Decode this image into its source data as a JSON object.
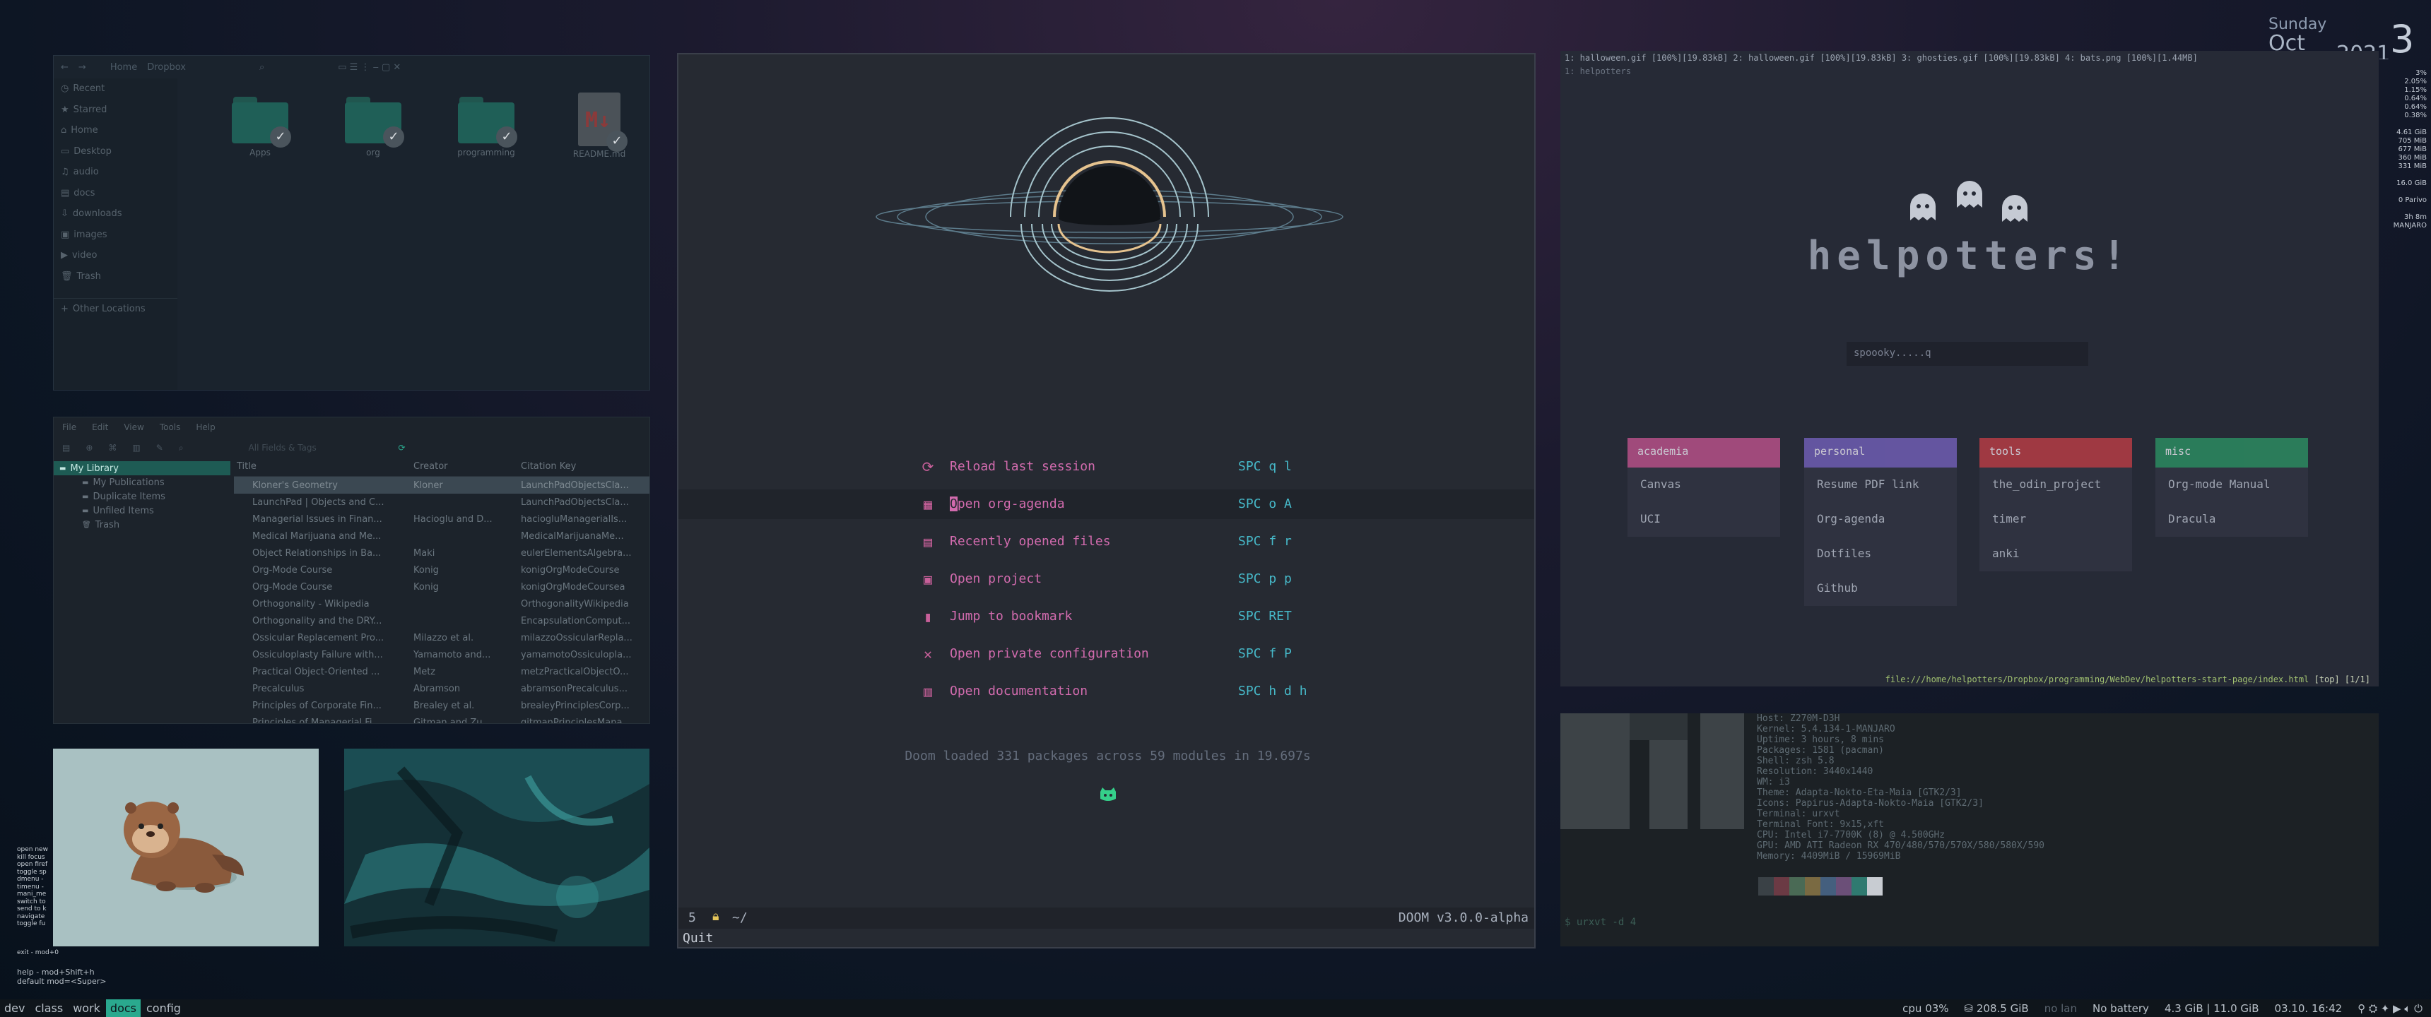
{
  "clock": {
    "day": "Sunday",
    "month": "Oct",
    "year": "2021",
    "daynum": "3"
  },
  "stats": [
    "3%",
    "2.05%",
    "1.15%",
    "0.64%",
    "0.64%",
    "0.38%",
    "",
    "4.61 GiB",
    "705 MiB",
    "677 MiB",
    "360 MiB",
    "331 MiB",
    "",
    "16.0 GiB",
    "",
    "0 Parivo",
    "",
    "3h 8m",
    "MANJARO"
  ],
  "filemanager": {
    "path": [
      "Home",
      "Dropbox"
    ],
    "sidebar": [
      "Recent",
      "Starred",
      "Home",
      "Desktop",
      "audio",
      "docs",
      "downloads",
      "images",
      "video",
      "Trash",
      "Other Locations"
    ],
    "items": [
      "Apps",
      "org",
      "programming",
      "README.md"
    ]
  },
  "zotero": {
    "menu": [
      "File",
      "Edit",
      "View",
      "Tools",
      "Help"
    ],
    "search_placeholder": "All Fields & Tags",
    "tree": [
      "My Library",
      "My Publications",
      "Duplicate Items",
      "Unfiled Items",
      "Trash"
    ],
    "columns": [
      "Title",
      "Creator",
      "Citation Key"
    ],
    "rows": [
      [
        "Kloner's Geometry",
        "Kloner",
        "LaunchPadObjectsCla..."
      ],
      [
        "LaunchPad | Objects and C...",
        "",
        "LaunchPadObjectsCla..."
      ],
      [
        "Managerial Issues in Finan...",
        "Hacioglu and D...",
        "haciogluManagerialIs..."
      ],
      [
        "Medical Marijuana and Me...",
        "",
        "MedicalMarijuanaMe..."
      ],
      [
        "Object Relationships in Ba...",
        "Maki",
        "eulerElementsAlgebra..."
      ],
      [
        "Org-Mode Course",
        "Konig",
        "konigOrgModeCourse"
      ],
      [
        "Org-Mode Course",
        "Konig",
        "konigOrgModeCoursea"
      ],
      [
        "Orthogonality - Wikipedia",
        "",
        "OrthogonalityWikipedia"
      ],
      [
        "Orthogonality and the DRY...",
        "",
        "EncapsulationComput..."
      ],
      [
        "Ossicular Replacement Pro...",
        "Milazzo et al.",
        "milazzoOssicularRepla..."
      ],
      [
        "Ossiculoplasty Failure with...",
        "Yamamoto and...",
        "yamamotoOssiculopla..."
      ],
      [
        "Practical Object-Oriented ...",
        "Metz",
        "metzPracticalObjectO..."
      ],
      [
        "Precalculus",
        "Abramson",
        "abramsonPrecalculus..."
      ],
      [
        "Principles of Corporate Fin...",
        "Brealey et al.",
        "brealeyPrinciplesCorp..."
      ],
      [
        "Principles of Managerial Fi...",
        "Gitman and Zu...",
        "gitmanPrinciplesMana..."
      ]
    ]
  },
  "doom": {
    "menu": [
      {
        "icon": "reload-icon",
        "glyph": "⟳",
        "label": "Reload last session",
        "key": "SPC q l"
      },
      {
        "icon": "calendar-icon",
        "glyph": "▦",
        "label": "Open org-agenda",
        "key": "SPC o A"
      },
      {
        "icon": "file-icon",
        "glyph": "▤",
        "label": "Recently opened files",
        "key": "SPC f r"
      },
      {
        "icon": "briefcase-icon",
        "glyph": "▣",
        "label": "Open project",
        "key": "SPC p p"
      },
      {
        "icon": "bookmark-icon",
        "glyph": "▮",
        "label": "Jump to bookmark",
        "key": "SPC RET"
      },
      {
        "icon": "tools-icon",
        "glyph": "✕",
        "label": "Open private configuration",
        "key": "SPC f P"
      },
      {
        "icon": "book-icon",
        "glyph": "▥",
        "label": "Open documentation",
        "key": "SPC h d h"
      }
    ],
    "loaded": "Doom loaded 331 packages across 59 modules in 19.697s",
    "modeline_num": "5",
    "modeline_path": "~/",
    "modeline_version": "DOOM v3.0.0-alpha",
    "minibuffer": "Quit"
  },
  "browser": {
    "tabs": "1: halloween.gif [100%][19.83kB]   2: halloween.gif [100%][19.83kB]   3: ghosties.gif [100%][19.83kB]   4: bats.png [100%][1.44MB]",
    "title": "1: helpotters",
    "brand": "helpotters!",
    "search_placeholder": "spoooky.....q",
    "cards": [
      {
        "title": "academia",
        "color": "#b44f86",
        "items": [
          "Canvas",
          "UCI"
        ]
      },
      {
        "title": "personal",
        "color": "#6d5cb1",
        "items": [
          "Resume PDF link",
          "Org-agenda",
          "Dotfiles",
          "Github"
        ]
      },
      {
        "title": "tools",
        "color": "#b33b43",
        "items": [
          "the_odin_project",
          "timer",
          "anki"
        ]
      },
      {
        "title": "misc",
        "color": "#2a8a5f",
        "items": [
          "Org-mode Manual",
          "Dracula"
        ]
      }
    ],
    "footer_path": "file:///home/helpotters/Dropbox/programming/WebDev/helpotters-start-page/index.html",
    "footer_pos": "[top] [1/1]"
  },
  "terminal": {
    "neofetch": [
      "Host: Z270M-D3H",
      "Kernel: 5.4.134-1-MANJARO",
      "Uptime: 3 hours, 8 mins",
      "Packages: 1581 (pacman)",
      "Shell: zsh 5.8",
      "Resolution: 3440x1440",
      "WM: i3",
      "Theme: Adapta-Nokto-Eta-Maia [GTK2/3]",
      "Icons: Papirus-Adapta-Nokto-Maia [GTK2/3]",
      "Terminal: urxvt",
      "Terminal Font: 9x15,xft",
      "CPU: Intel i7-7700K (8) @ 4.500GHz",
      "GPU: AMD ATI Radeon RX 470/480/570/570X/580/580X/590",
      "Memory: 4409MiB / 15969MiB"
    ],
    "prompt": "$ urxvt -d 4"
  },
  "hints": [
    "open new",
    "kill focus",
    "open firef",
    "toggle sp",
    "dmenu -",
    "timenu -",
    "mani_me",
    "switch to",
    "send to k",
    "navigate",
    "toggle fu"
  ],
  "hints_bottom": [
    "help - mod+Shift+h",
    "default mod=<Super>"
  ],
  "hint_exit": "exit - mod+0",
  "bar": {
    "workspaces": [
      "dev",
      "class",
      "work",
      "docs",
      "config"
    ],
    "active": "docs",
    "cpu": "cpu  03%",
    "disk": "208.5 GiB",
    "lan": "no lan",
    "battery": "No battery",
    "memory": "4.3 GiB | 11.0 GiB",
    "datetime": "03.10. 16:42"
  }
}
